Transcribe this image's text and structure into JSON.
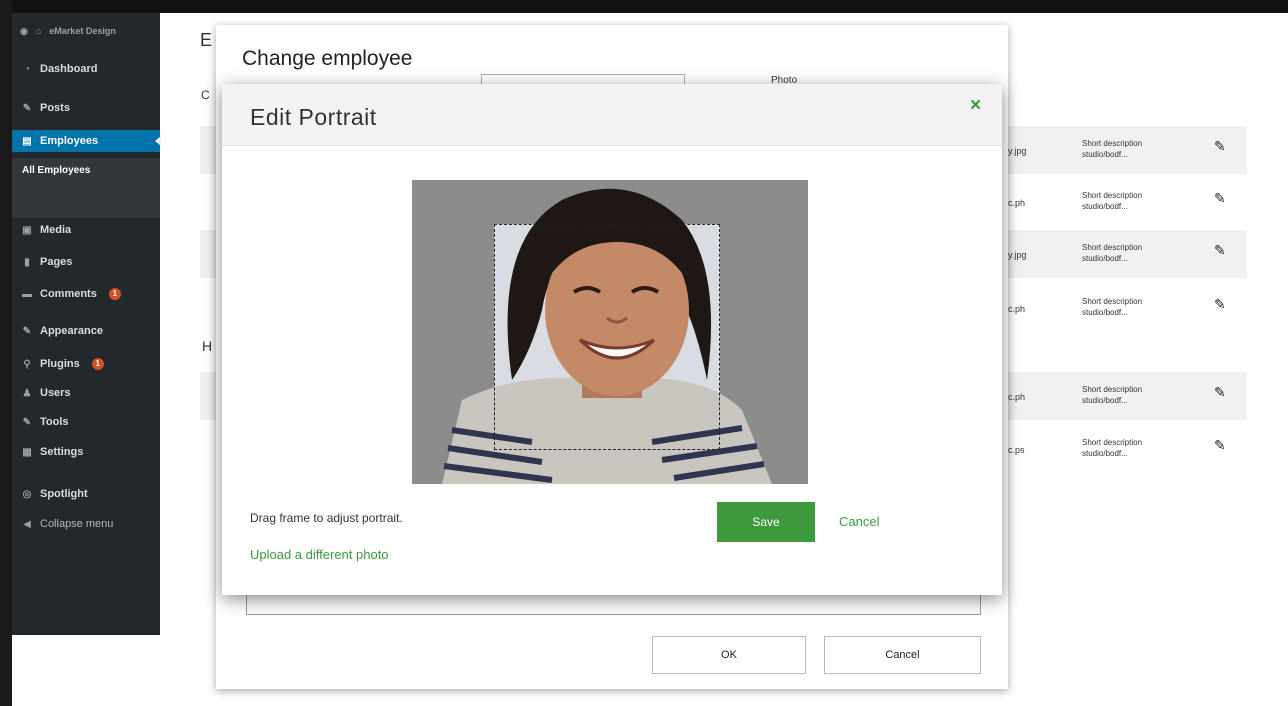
{
  "admin_sidebar": {
    "site_name": "eMarket Design",
    "items": [
      {
        "label": "Dashboard",
        "icon": "dashboard-icon",
        "glyph": "◔"
      },
      {
        "label": "Posts",
        "icon": "pin-icon",
        "glyph": "✎"
      },
      {
        "label": "Employees",
        "icon": "employees-icon",
        "glyph": "▤",
        "active": true
      },
      {
        "label": "Media",
        "icon": "media-icon",
        "glyph": "▣"
      },
      {
        "label": "Pages",
        "icon": "pages-icon",
        "glyph": "▮"
      },
      {
        "label": "Comments",
        "icon": "comments-icon",
        "glyph": "▬",
        "badge": "1"
      },
      {
        "label": "Appearance",
        "icon": "appearance-icon",
        "glyph": "✎"
      },
      {
        "label": "Plugins",
        "icon": "plugins-icon",
        "glyph": "⚲",
        "badge": "1"
      },
      {
        "label": "Users",
        "icon": "users-icon",
        "glyph": "♟"
      },
      {
        "label": "Tools",
        "icon": "tools-icon",
        "glyph": "✎"
      },
      {
        "label": "Settings",
        "icon": "settings-icon",
        "glyph": "▦"
      },
      {
        "label": "Spotlight",
        "icon": "spotlight-icon",
        "glyph": "◎"
      },
      {
        "label": "Collapse menu",
        "icon": "collapse-icon",
        "glyph": "◀"
      }
    ],
    "submenu": {
      "label": "All Employees"
    }
  },
  "background": {
    "letters": [
      "E",
      "C",
      "H"
    ],
    "rows": [
      {
        "file": "ey.jpg",
        "desc": "Short description\nstudio/bodf..."
      },
      {
        "file": "ec.ph",
        "desc": "Short description\nstudio/bodf..."
      },
      {
        "file": "ey.jpg",
        "desc": "Short description\nstudio/bodf..."
      },
      {
        "file": "ec.ph",
        "desc": "Short description\nstudio/bodf..."
      },
      {
        "file": "ec.ph",
        "desc": "Short description\nstudio/bodf..."
      },
      {
        "file": "ec.ps",
        "desc": "Short description\nstudio/bodf..."
      }
    ]
  },
  "change_employee": {
    "title": "Change employee",
    "photo_label": "Photo",
    "ok_label": "OK",
    "cancel_label": "Cancel"
  },
  "edit_portrait": {
    "title": "Edit Portrait",
    "close_glyph": "×",
    "hint": "Drag frame to adjust portrait.",
    "upload_label": "Upload a different photo",
    "save_label": "Save",
    "cancel_label": "Cancel"
  },
  "colors": {
    "accent_green": "#3c9a3c",
    "sidebar_bg": "#23282d",
    "sidebar_active": "#0073aa"
  }
}
